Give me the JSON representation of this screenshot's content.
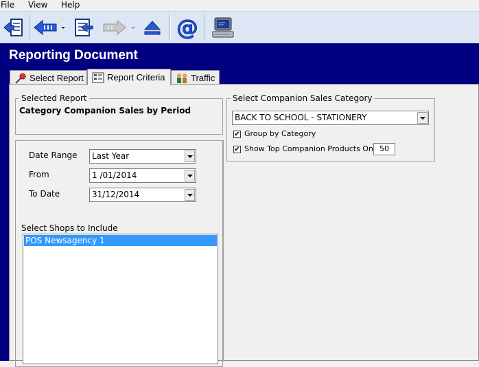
{
  "menu": {
    "file": "File",
    "view": "View",
    "help": "Help"
  },
  "toolbar": {
    "icons": [
      "exit-icon",
      "back-arrow-icon",
      "dropdown-icon",
      "document-list-icon",
      "forward-arrow-icon",
      "dropdown-icon",
      "eject-icon",
      "email-at-icon",
      "terminal-icon"
    ]
  },
  "title": "Reporting Document",
  "tabs": [
    {
      "label": "Select Report",
      "icon": "pin-icon"
    },
    {
      "label": "Report Criteria",
      "icon": "criteria-icon"
    },
    {
      "label": "Traffic",
      "icon": "people-icon"
    }
  ],
  "selected_report": {
    "heading": "Selected Report",
    "name": "Category Companion Sales by Period"
  },
  "criteria": {
    "date_range_label": "Date Range",
    "date_range_value": "Last Year",
    "from_label": "From",
    "from_value": "1 /01/2014",
    "to_label": "To Date",
    "to_value": "31/12/2014",
    "shops_label": "Select Shops to Include",
    "shops": [
      "POS Newsagency 1"
    ]
  },
  "companion": {
    "heading": "Select Companion Sales Category",
    "category_value": "BACK TO SCHOOL - STATIONERY",
    "group_by_label": "Group by Category",
    "group_by_checked": true,
    "top_only_label": "Show Top Companion Products Only",
    "top_only_checked": true,
    "top_count": "50"
  },
  "colors": {
    "header_bg": "#000080",
    "selection": "#3399ff",
    "toolbar_bg": "#dce6f4"
  }
}
